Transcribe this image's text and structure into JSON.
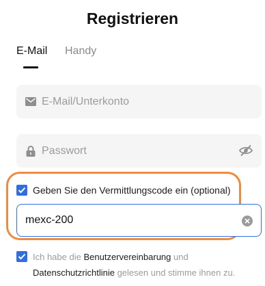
{
  "title": "Registrieren",
  "tabs": [
    {
      "label": "E-Mail",
      "active": true
    },
    {
      "label": "Handy",
      "active": false
    }
  ],
  "email_field": {
    "placeholder": "E-Mail/Unterkonto",
    "icon": "envelope-icon"
  },
  "password_field": {
    "placeholder": "Passwort",
    "icon": "lock-icon",
    "toggle_icon": "eye-slash-icon"
  },
  "referral": {
    "checkbox_checked": true,
    "label": "Geben Sie den Vermittlungscode ein (optional)",
    "value": "mexc-200",
    "clear_icon": "clear-icon"
  },
  "agreement": {
    "checked": true,
    "prefix": "Ich habe die",
    "terms_link": "Benutzervereinbarung",
    "and": "und",
    "privacy_link": "Datenschutzrichtlinie",
    "suffix": "gelesen und stimme ihnen zu."
  },
  "colors": {
    "accent_blue": "#2f6fe0",
    "highlight_orange": "#f08a3c",
    "field_bg": "#f5f5f5"
  }
}
